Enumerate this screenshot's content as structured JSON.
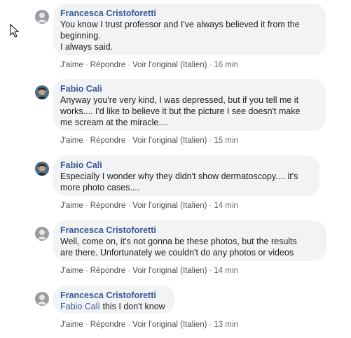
{
  "comments": [
    {
      "author": "Francesca Cristoforetti",
      "text": "You know I trust professor and I've always believed it from the\nbeginning.\nI always said.",
      "avatar": "default-avatar",
      "actions": {
        "like": "J'aime",
        "reply": "Répondre",
        "see_original": "Voir l'original (Italien)",
        "time": "16 min"
      }
    },
    {
      "author": "Fabio Calì",
      "text": "Anyway you're very kind, I was depressed, but if you tell me it\nworks.... I'd like to believe it but the picture I see doesn't make\nme scream at the miracle....",
      "avatar": "photo-avatar",
      "actions": {
        "like": "J'aime",
        "reply": "Répondre",
        "see_original": "Voir l'original (Italien)",
        "time": "15 min"
      }
    },
    {
      "author": "Fabio Calì",
      "text": "Especially I wonder why they didn't show dermatoscopy.... it's\nmore photo cases....",
      "avatar": "photo-avatar",
      "actions": {
        "like": "J'aime",
        "reply": "Répondre",
        "see_original": "Voir l'original (Italien)",
        "time": "14 min"
      }
    },
    {
      "author": "Francesca Cristoforetti",
      "text": "Well, come on, it's not gonna be these photos, but the results\nare there. Unfortunately we couldn't do any photos or videos",
      "avatar": "default-avatar",
      "actions": {
        "like": "J'aime",
        "reply": "Répondre",
        "see_original": "Voir l'original (Italien)",
        "time": "14 min"
      }
    },
    {
      "author": "Francesca Cristoforetti",
      "mention": "Fabio Calì",
      "text": " this I don't know",
      "avatar": "default-avatar",
      "actions": {
        "like": "J'aime",
        "reply": "Répondre",
        "see_original": "Voir l'original (Italien)",
        "time": "13 min"
      }
    }
  ],
  "colors": {
    "author": "#385898",
    "bubble_bg": "#f2f3f5",
    "meta": "#606770"
  }
}
